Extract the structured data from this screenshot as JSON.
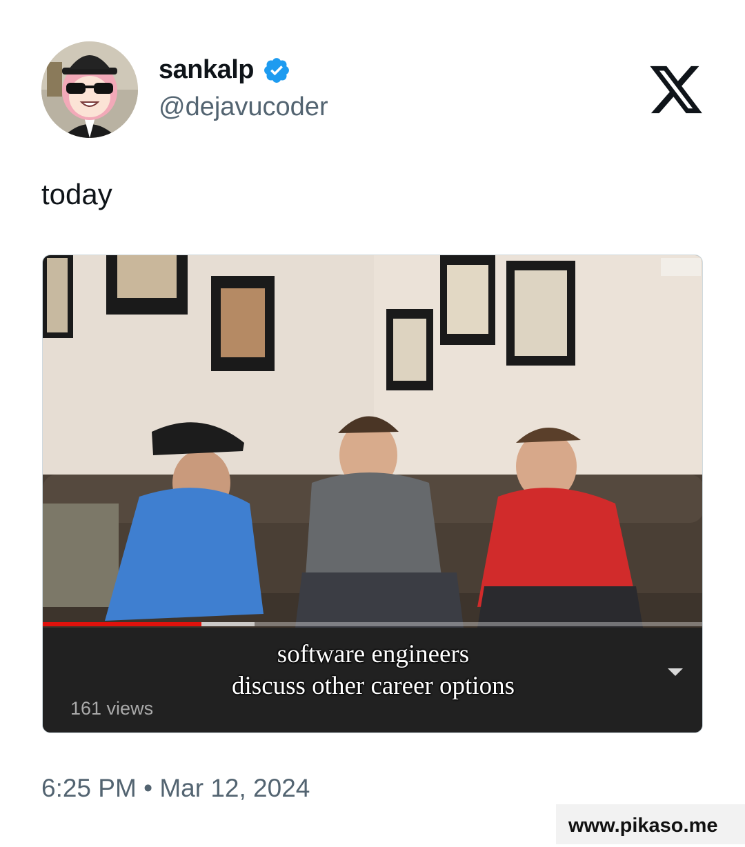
{
  "author": {
    "display_name": "sankalp",
    "handle": "@dejavucoder",
    "verified": true
  },
  "icons": {
    "verified_badge": "verified-badge-icon",
    "x_logo": "x-logo-icon",
    "expand": "chevron-down-icon"
  },
  "colors": {
    "verified": "#1d9bf0",
    "progress": "#e0120c",
    "secondary_text": "#536471"
  },
  "tweet": {
    "text": "today"
  },
  "media": {
    "caption_line1": "software engineers",
    "caption_line2": "discuss other career options",
    "views": "161 views",
    "progress_fraction": 0.24,
    "buffered_fraction": 0.32
  },
  "meta": {
    "time": "6:25 PM",
    "separator": "•",
    "date": "Mar 12, 2024"
  },
  "watermark": "www.pikaso.me"
}
